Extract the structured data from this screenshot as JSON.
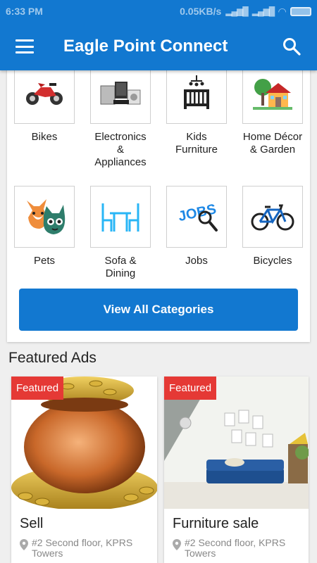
{
  "status_bar": {
    "time": "6:33 PM",
    "speed": "0.05KB/s"
  },
  "app_bar": {
    "title": "Eagle Point Connect",
    "menu_icon": "hamburger-icon",
    "search_icon": "search-icon"
  },
  "categories": [
    {
      "label": "Bikes",
      "icon": "motorbike-icon"
    },
    {
      "label": "Electronics & Appliances",
      "icon": "electronics-icon"
    },
    {
      "label": "Kids Furniture",
      "icon": "crib-icon"
    },
    {
      "label": "Home Décor & Garden",
      "icon": "house-icon"
    },
    {
      "label": "Pets",
      "icon": "pets-icon"
    },
    {
      "label": "Sofa & Dining",
      "icon": "dining-icon"
    },
    {
      "label": "Jobs",
      "icon": "jobs-icon"
    },
    {
      "label": "Bicycles",
      "icon": "bicycle-icon"
    }
  ],
  "view_all_label": "View All Categories",
  "featured": {
    "heading": "Featured Ads",
    "ads": [
      {
        "badge": "Featured",
        "title": "Sell",
        "location": "#2 Second floor, KPRS Towers"
      },
      {
        "badge": "Featured",
        "title": "Furniture sale",
        "location": "#2 Second floor, KPRS Towers"
      }
    ]
  },
  "colors": {
    "primary": "#1278d0",
    "badge": "#e53935"
  }
}
